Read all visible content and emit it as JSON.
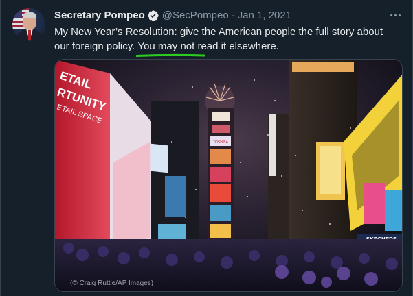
{
  "tweet": {
    "author_name": "Secretary Pompeo",
    "handle": "@SecPompeo",
    "separator": "·",
    "date": "Jan 1, 2021",
    "text_part1": "My New Year’s Resolution: give the American people the full story about our foreign policy. ",
    "text_highlight": "You may not read it elsewhere.",
    "highlight_color": "#2ecc1f",
    "verified_color": "#e7e9ea",
    "avatar_icon": "avatar-photo",
    "more_icon": "more-horizontal-icon"
  },
  "media": {
    "description_icon": "times-square-photo",
    "credit": "(© Craig Ruttle/AP Images)",
    "signs": {
      "left_billboard": "ETAIL\nRTUNITY\nETAIL SPACE",
      "toshiba": "TOSHIBA",
      "skechers": "SKECHERS"
    }
  },
  "colors": {
    "background": "#15202b",
    "border": "#38444d",
    "secondary_text": "#8b98a5",
    "primary_text": "#e7e9ea"
  }
}
